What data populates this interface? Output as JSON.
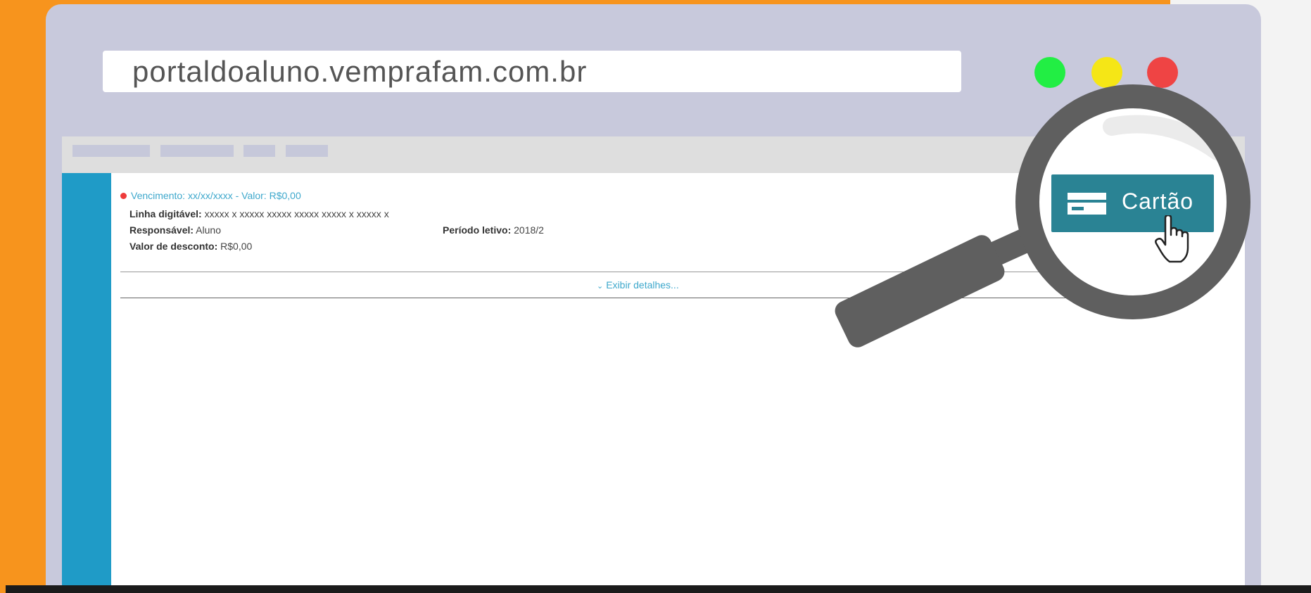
{
  "browser": {
    "url": "portaldoaluno.vemprafam.com.br",
    "window_controls": [
      "green-dot",
      "yellow-dot",
      "red-dot"
    ]
  },
  "invoice": {
    "due_line": "Vencimento: xx/xx/xxxx - Valor: R$0,00",
    "fields": {
      "linha_label": "Linha digitável:",
      "linha_value": "xxxxx x xxxxx xxxxx xxxxx xxxxx x xxxxx x",
      "responsavel_label": "Responsável:",
      "responsavel_value": "Aluno",
      "periodo_label": "Período letivo:",
      "periodo_value": "2018/2",
      "desconto_label": "Valor de desconto:",
      "desconto_value": "R$0,00"
    },
    "details_link": "Exibir detalhes..."
  },
  "magnified": {
    "card_button_label": "Cartão",
    "icons": [
      "credit-card-icon",
      "hand-pointer-icon"
    ]
  },
  "colors": {
    "orange_background": "#f7941d",
    "browser_frame": "#c8c9dc",
    "sidebar": "#1f9bc7",
    "card_button": "#2a8394",
    "link": "#3ea8cc"
  }
}
